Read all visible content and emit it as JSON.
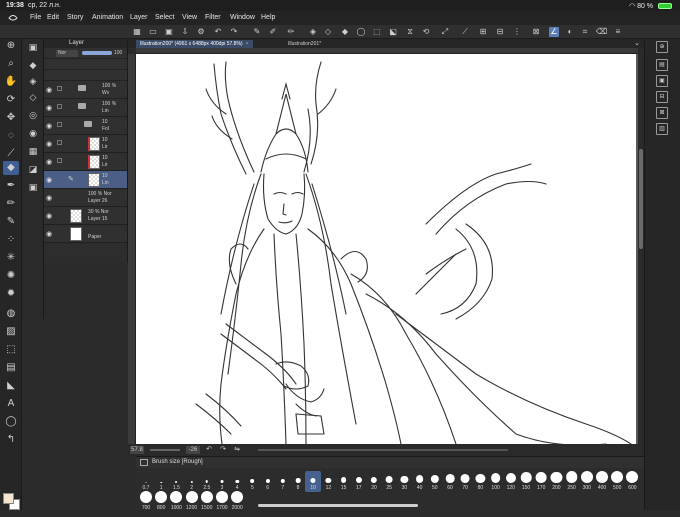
{
  "status": {
    "time": "19:38",
    "date": "ср, 22 л.н.",
    "battery": "80 %"
  },
  "menu": {
    "items": [
      "File",
      "Edit",
      "Story",
      "Animation",
      "Layer",
      "Select",
      "View",
      "Filter",
      "Window",
      "Help"
    ]
  },
  "layer_panel": {
    "title": "Layer",
    "blend_mode": "Nor",
    "opacity": "100",
    "layers": [
      {
        "pct": "100 %",
        "name": "Wv",
        "type": "folder"
      },
      {
        "pct": "100 %",
        "name": "Lin",
        "type": "folder"
      },
      {
        "pct": "10",
        "name": "Fol",
        "type": "folder-open"
      },
      {
        "pct": "10",
        "name": "Lir",
        "type": "raster-red"
      },
      {
        "pct": "10",
        "name": "Lir",
        "type": "raster-red"
      },
      {
        "pct": "10",
        "name": "Lin",
        "type": "raster",
        "selected": true
      },
      {
        "pct": "100 % Nor",
        "name": "Layer 26",
        "type": "blank"
      },
      {
        "pct": "30 % Nor",
        "name": "Layer 15",
        "type": "raster"
      },
      {
        "pct": "",
        "name": "Paper",
        "type": "paper"
      }
    ]
  },
  "tabs": [
    {
      "label": "Illustration200* (4961 x 6488px 400dpi 57.8%)",
      "active": true
    },
    {
      "label": "Illustration201*",
      "active": false
    }
  ],
  "navigator": {
    "zoom": "57.8",
    "rotation": "-26"
  },
  "brush_panel": {
    "title": "Brush size [Rough]",
    "row1": [
      "0.7",
      "1",
      "1.5",
      "2",
      "2.5",
      "3",
      "4",
      "5",
      "6",
      "7",
      "8",
      "10",
      "12",
      "15",
      "17",
      "20",
      "25",
      "30",
      "40",
      "50",
      "60",
      "70",
      "80",
      "100",
      "120",
      "150",
      "170",
      "200",
      "250",
      "300",
      "400",
      "500",
      "600"
    ],
    "row2": [
      "700",
      "800",
      "1000",
      "1200",
      "1500",
      "1700",
      "2000"
    ],
    "selected": "10"
  }
}
